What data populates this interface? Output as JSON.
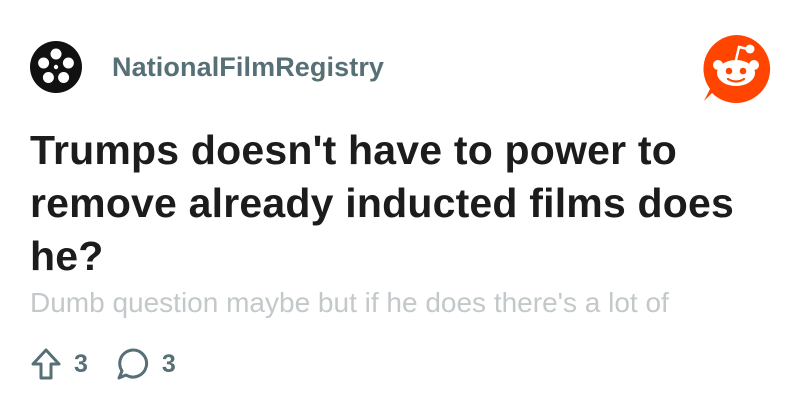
{
  "post": {
    "community": "NationalFilmRegistry",
    "community_icon": "film-reel-icon",
    "brand_icon": "reddit-snoo-icon",
    "title": "Trumps doesn't have to power to remove already inducted films does he?",
    "body_preview": "Dumb question maybe but if he does there's a lot of",
    "upvotes": "3",
    "comments": "3",
    "upvote_icon": "upvote-arrow-icon",
    "comment_icon": "comment-bubble-icon"
  },
  "colors": {
    "brand": "#ff4500",
    "meta_text": "#576f76",
    "title_text": "#1c1c1c",
    "faded_text": "#c3c8ca"
  }
}
